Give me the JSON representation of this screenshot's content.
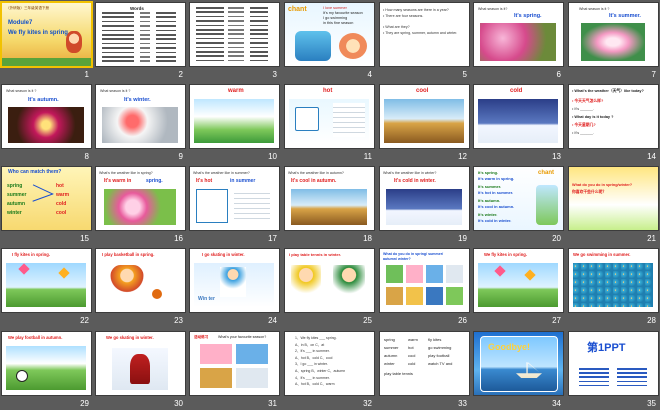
{
  "slide_numbers": [
    "1",
    "2",
    "3",
    "4",
    "5",
    "6",
    "7",
    "8",
    "9",
    "10",
    "11",
    "12",
    "13",
    "14",
    "15",
    "16",
    "17",
    "18",
    "19",
    "20",
    "21",
    "22",
    "23",
    "24",
    "25",
    "26",
    "27",
    "28",
    "29",
    "30",
    "31",
    "32",
    "33",
    "34",
    "35"
  ],
  "s1": {
    "head": "（外研版）三年级英语下册",
    "module": "Module7",
    "title": "We fly kites in spring."
  },
  "s2": {
    "title": "Words"
  },
  "s4": {
    "logo": "chant",
    "l1": "I love summer",
    "l2": "It's my favourite season",
    "l3": "I go swimming",
    "l4": "in this fine season"
  },
  "s5": {
    "q1": "• How many seasons are there in a year?",
    "q2": "• There are four seasons.",
    "q3": "• What are they?",
    "q4": "• They are spring, summer, autumn and winter."
  },
  "s6": {
    "q": "What season is it?",
    "a": "It's spring."
  },
  "s7": {
    "q": "What season is it ?",
    "a": "It's summer."
  },
  "s8": {
    "q": "What season is it ?",
    "a": "It's autumn."
  },
  "s9": {
    "q": "What season is it ?",
    "a": "It's winter."
  },
  "s10": {
    "word": "warm"
  },
  "s11": {
    "word": "hot"
  },
  "s12": {
    "word": "cool"
  },
  "s13": {
    "word": "cold"
  },
  "s14": {
    "l1": "• What's the weather（天气）like today?",
    "l2": "• 今天天气怎么样?",
    "l3": "• It's ______.",
    "l4": "• What day is it today ?",
    "l5": "• 今天星期几?",
    "l6": "• It's ______."
  },
  "s15": {
    "title": "Who can match them?",
    "seasons": [
      "spring",
      "summer",
      "autumn",
      "winter"
    ],
    "weather": [
      "hot",
      "warm",
      "cold",
      "cool"
    ]
  },
  "s16": {
    "q": "What's the weather like in spring?",
    "a1": "It's warm in",
    "a2": "spring."
  },
  "s17": {
    "q": "What's the weather like in summer?",
    "a1": "It's hot",
    "a2": "in summer"
  },
  "s18": {
    "q": "What's the weather like in autumn?",
    "a": "It's cool in autumn."
  },
  "s19": {
    "q": "What's the weather like in winter?",
    "a": "It's cold in winter."
  },
  "s20": {
    "logo": "chant",
    "l1": "It's spring.",
    "l2": "It's warm in spring.",
    "l3": "It's summer.",
    "l4": "It's hot in summer.",
    "l5": "It's autumn.",
    "l6": "It's cool in autumn.",
    "l7": "It's winter.",
    "l8": "It's cold in winter."
  },
  "s21": {
    "q": "What do you do in spring/winter?",
    "cn": "你喜欢干些什么呢？"
  },
  "s22": {
    "cap": "I fly kites in spring."
  },
  "s23": {
    "cap": "I play basketball in spring."
  },
  "s24": {
    "cap": "I go skating in winter.",
    "sign": "Win ter"
  },
  "s25": {
    "cap": "I play table tennis in winter."
  },
  "s26": {
    "q1": "What do you do in spring/ summer/",
    "q2": "autumn/ winter?"
  },
  "s27": {
    "cap": "We fly kites in spring."
  },
  "s28": {
    "cap": "We go swimming in summer."
  },
  "s29": {
    "cap": "We play football in autumn."
  },
  "s30": {
    "cap": "We go skating in winter."
  },
  "s31": {
    "head1": "活动练习",
    "head2": "What's your favourite season?"
  },
  "s32": {
    "l1": "1、We fly kites ___ spring.",
    "l2": "A、in  B、on  C、at",
    "l3": "2、It's ___ in summer.",
    "l4": "A、hot  B、cold  C、cool",
    "l5": "3、I go ___ in winter.",
    "l6": "A、spring  B、winter  C、autumn",
    "l7": "4、It's ___ in summer.",
    "l8": "A、hot  B、cold  C、warm"
  },
  "s33": {
    "c1": [
      "spring",
      "summer",
      "autumn",
      "winter"
    ],
    "c2": [
      "warm",
      "hot",
      "cool",
      "cold"
    ],
    "c3": [
      "fly kites",
      "go swimming",
      "play football",
      "watch TV and"
    ],
    "c4": "play table tennis"
  },
  "s34": {
    "word": "Goodbye!"
  },
  "s35": {
    "logo": "第1PPT"
  }
}
